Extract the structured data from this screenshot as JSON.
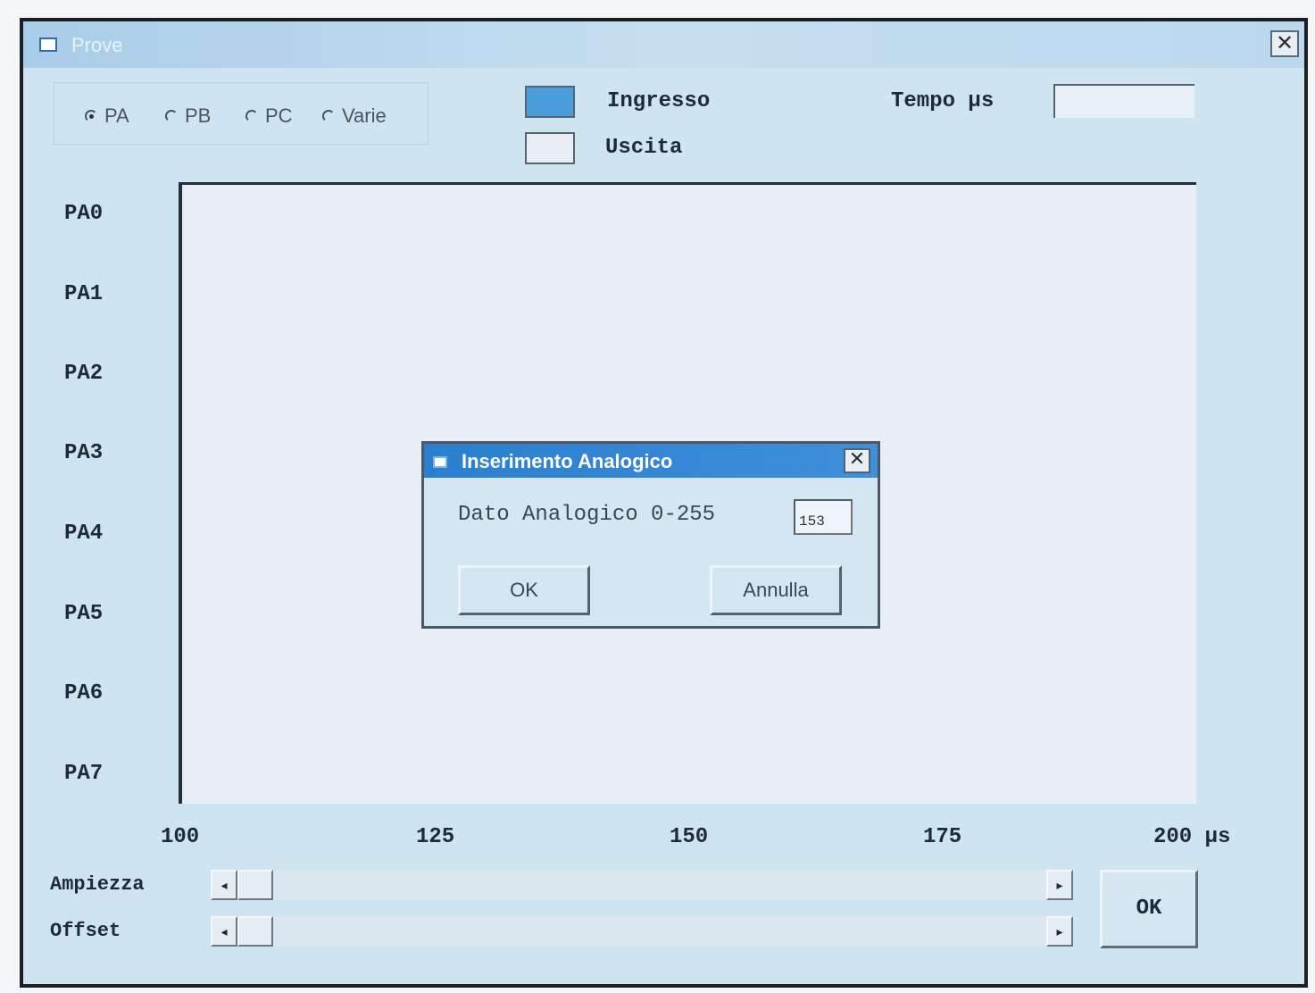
{
  "window": {
    "title": "Prove",
    "close_glyph": "✕"
  },
  "port_selector": {
    "options": [
      {
        "label": "PA",
        "checked": true
      },
      {
        "label": "PB",
        "checked": false
      },
      {
        "label": "PC",
        "checked": false
      },
      {
        "label": "Varie",
        "checked": false
      }
    ]
  },
  "legend": {
    "input_label": "Ingresso",
    "input_color": "#4a9edc",
    "output_label": "Uscita",
    "output_color": "#e8eef3"
  },
  "tempo": {
    "label": "Tempo µs",
    "value": ""
  },
  "ports": [
    "PA0",
    "PA1",
    "PA2",
    "PA3",
    "PA4",
    "PA5",
    "PA6",
    "PA7"
  ],
  "axis": {
    "ticks": [
      "100",
      "125",
      "150",
      "175",
      "200 µs"
    ]
  },
  "sliders": {
    "amplitude_label": "Ampiezza",
    "offset_label": "Offset",
    "left_arrow": "◂",
    "right_arrow": "▸",
    "amplitude_value": 0,
    "offset_value": 0
  },
  "main_ok_label": "OK",
  "dialog": {
    "title": "Inserimento Analogico",
    "close_glyph": "✕",
    "prompt": "Dato Analogico 0-255",
    "value": "153",
    "ok_label": "OK",
    "cancel_label": "Annulla"
  }
}
